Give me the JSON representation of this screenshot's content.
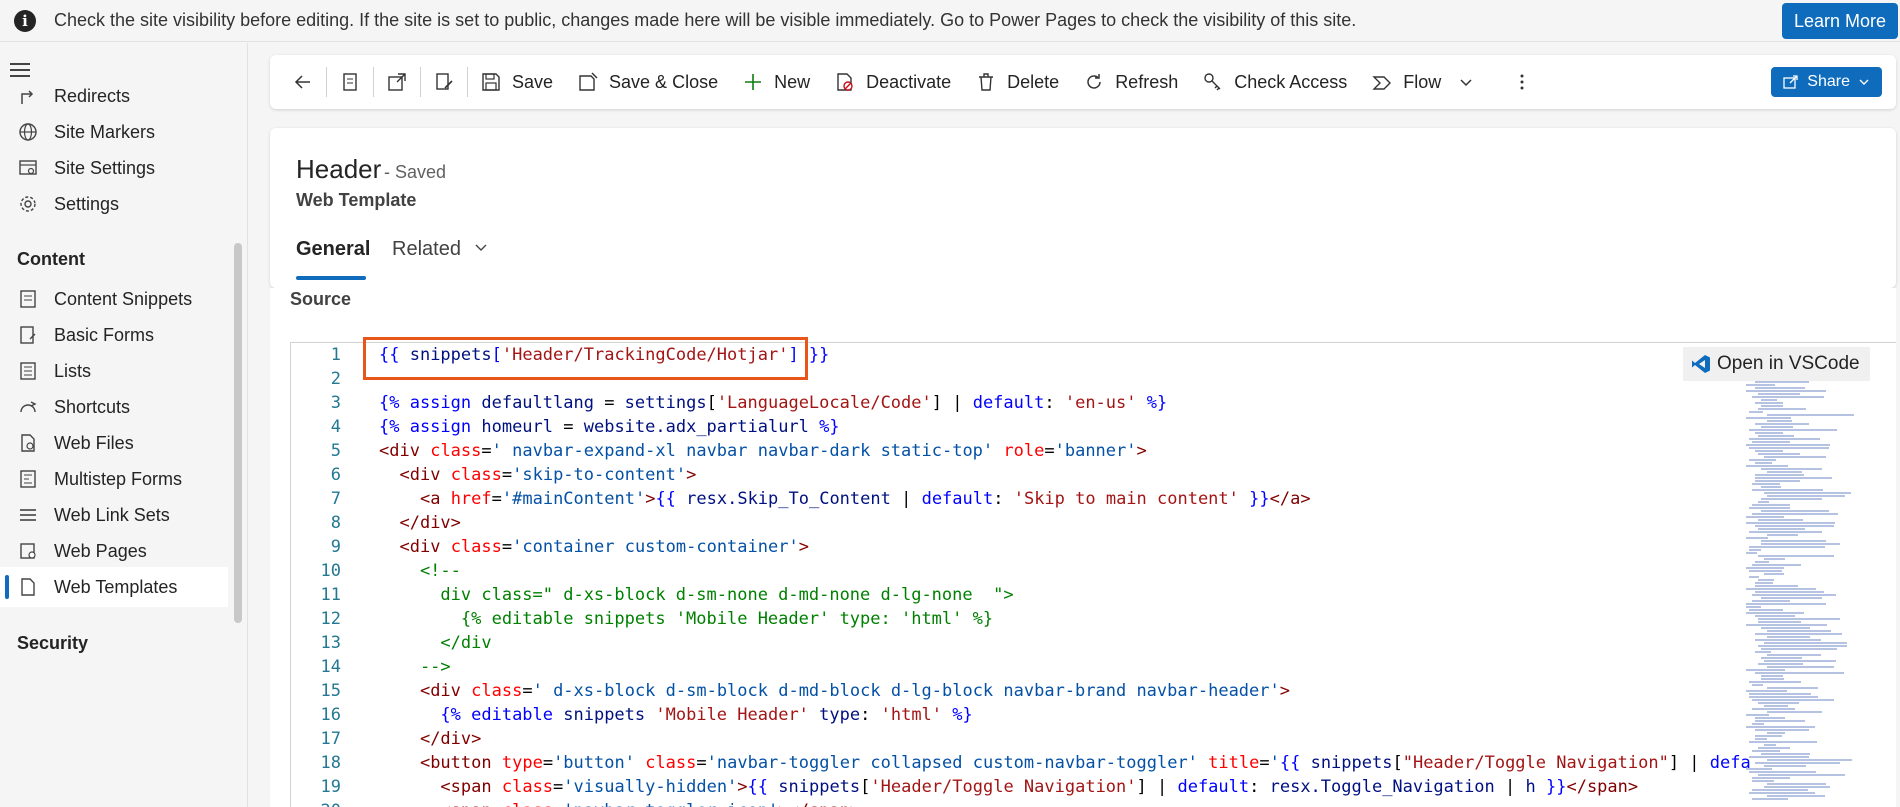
{
  "notice": {
    "message": "Check the site visibility before editing. If the site is set to public, changes made here will be visible immediately. Go to Power Pages to check the visibility of this site.",
    "learn_more": "Learn More"
  },
  "sidebar": {
    "items_top": [
      {
        "label": "Redirects",
        "icon": "redirect-icon"
      },
      {
        "label": "Site Markers",
        "icon": "globe-icon"
      },
      {
        "label": "Site Settings",
        "icon": "site-settings-icon"
      },
      {
        "label": "Settings",
        "icon": "gear-icon"
      }
    ],
    "section_content": "Content",
    "items_content": [
      {
        "label": "Content Snippets",
        "icon": "snippet-icon"
      },
      {
        "label": "Basic Forms",
        "icon": "form-icon"
      },
      {
        "label": "Lists",
        "icon": "list-icon"
      },
      {
        "label": "Shortcuts",
        "icon": "shortcut-icon"
      },
      {
        "label": "Web Files",
        "icon": "file-icon"
      },
      {
        "label": "Multistep Forms",
        "icon": "multistep-icon"
      },
      {
        "label": "Web Link Sets",
        "icon": "link-set-icon"
      },
      {
        "label": "Web Pages",
        "icon": "web-page-icon"
      },
      {
        "label": "Web Templates",
        "icon": "template-icon",
        "active": true
      }
    ],
    "section_security": "Security"
  },
  "toolbar": {
    "save": "Save",
    "save_close": "Save & Close",
    "new": "New",
    "deactivate": "Deactivate",
    "delete": "Delete",
    "refresh": "Refresh",
    "check_access": "Check Access",
    "flow": "Flow",
    "share": "Share"
  },
  "record": {
    "title": "Header",
    "status": "- Saved",
    "entity": "Web Template"
  },
  "tabs": {
    "general": "General",
    "related": "Related"
  },
  "source_label": "Source",
  "open_vscode": "Open in VSCode",
  "code_lines": [
    {
      "n": "1",
      "text": "{{ snippets['Header/TrackingCode/Hotjar'] }}"
    },
    {
      "n": "2",
      "text": ""
    },
    {
      "n": "3",
      "text": "{% assign defaultlang = settings['LanguageLocale/Code'] | default: 'en-us' %}"
    },
    {
      "n": "4",
      "text": "{% assign homeurl = website.adx_partialurl %}"
    },
    {
      "n": "5",
      "text": "<div class=' navbar-expand-xl navbar navbar-dark static-top' role='banner'>"
    },
    {
      "n": "6",
      "text": "  <div class='skip-to-content'>"
    },
    {
      "n": "7",
      "text": "    <a href='#mainContent'>{{ resx.Skip_To_Content | default: 'Skip to main content' }}</a>"
    },
    {
      "n": "8",
      "text": "  </div>"
    },
    {
      "n": "9",
      "text": "  <div class='container custom-container'>"
    },
    {
      "n": "10",
      "text": "    <!--"
    },
    {
      "n": "11",
      "text": "      div class=\" d-xs-block d-sm-none d-md-none d-lg-none  \">"
    },
    {
      "n": "12",
      "text": "        {% editable snippets 'Mobile Header' type: 'html' %}"
    },
    {
      "n": "13",
      "text": "      </div"
    },
    {
      "n": "14",
      "text": "    -->"
    },
    {
      "n": "15",
      "text": "    <div class=' d-xs-block d-sm-block d-md-block d-lg-block navbar-brand navbar-header'>"
    },
    {
      "n": "16",
      "text": "      {% editable snippets 'Mobile Header' type: 'html' %}"
    },
    {
      "n": "17",
      "text": "    </div>"
    },
    {
      "n": "18",
      "text": "    <button type='button' class='navbar-toggler collapsed custom-navbar-toggler' title='{{ snippets[\"Header/Toggle Navigation\"] | default: res"
    },
    {
      "n": "19",
      "text": "      <span class='visually-hidden'>{{ snippets['Header/Toggle Navigation'] | default: resx.Toggle_Navigation | h }}</span>"
    },
    {
      "n": "20",
      "text": "      <span class='navbar-toggler-icon'></span>"
    }
  ]
}
